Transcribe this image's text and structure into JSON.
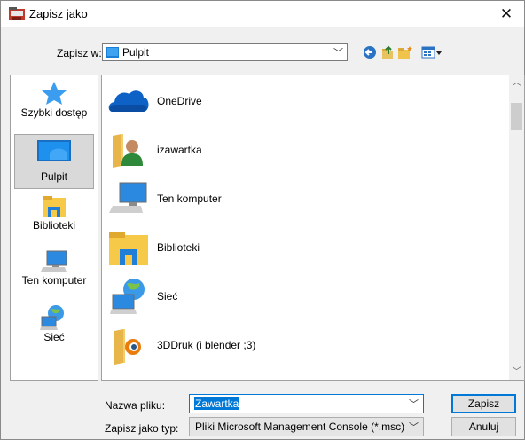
{
  "window": {
    "title": "Zapisz jako",
    "close_glyph": "✕"
  },
  "toolbar": {
    "save_in_label": "Zapisz w:",
    "save_in_value": "Pulpit",
    "icons": [
      "back-icon",
      "up-folder-icon",
      "new-folder-icon",
      "view-menu-icon"
    ]
  },
  "places": [
    {
      "label": "Szybki dostęp",
      "icon": "star-icon",
      "selected": false
    },
    {
      "label": "Pulpit",
      "icon": "desktop-icon",
      "selected": true
    },
    {
      "label": "Biblioteki",
      "icon": "libraries-icon",
      "selected": false
    },
    {
      "label": "Ten komputer",
      "icon": "computer-icon",
      "selected": false
    },
    {
      "label": "Sieć",
      "icon": "network-icon",
      "selected": false
    }
  ],
  "files": [
    {
      "label": "OneDrive",
      "icon": "onedrive-icon"
    },
    {
      "label": "izawartka",
      "icon": "user-folder-icon"
    },
    {
      "label": "Ten komputer",
      "icon": "computer-icon"
    },
    {
      "label": "Biblioteki",
      "icon": "libraries-icon"
    },
    {
      "label": "Sieć",
      "icon": "network-icon"
    },
    {
      "label": "3DDruk (i blender ;3)",
      "icon": "blender-folder-icon"
    }
  ],
  "form": {
    "filename_label": "Nazwa pliku:",
    "filename_value": "Zawartka",
    "filetype_label": "Zapisz jako typ:",
    "filetype_value": "Pliki Microsoft Management Console (*.msc)"
  },
  "buttons": {
    "save": "Zapisz",
    "cancel": "Anuluj"
  },
  "colors": {
    "accent": "#0078d7",
    "selection": "#d9d9d9"
  }
}
